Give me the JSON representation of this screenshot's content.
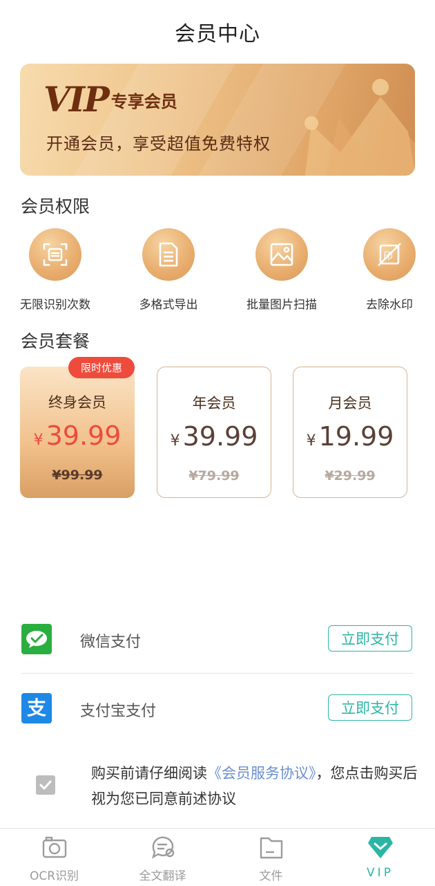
{
  "page": {
    "title": "会员中心"
  },
  "banner": {
    "vip_text": "VIP",
    "subtitle": "专享会员",
    "description": "开通会员，享受超值免费特权"
  },
  "perks": {
    "section_title": "会员权限",
    "items": [
      {
        "label": "无限识别次数",
        "icon": "scan-icon"
      },
      {
        "label": "多格式导出",
        "icon": "document-icon"
      },
      {
        "label": "批量图片扫描",
        "icon": "image-icon"
      },
      {
        "label": "去除水印",
        "icon": "no-watermark-icon"
      }
    ]
  },
  "plans": {
    "section_title": "会员套餐",
    "items": [
      {
        "name": "终身会员",
        "currency": "¥",
        "price": "39.99",
        "original": "¥99.99",
        "badge": "限时优惠",
        "selected": true
      },
      {
        "name": "年会员",
        "currency": "¥",
        "price": "39.99",
        "original": "¥79.99",
        "selected": false
      },
      {
        "name": "月会员",
        "currency": "¥",
        "price": "19.99",
        "original": "¥29.99",
        "selected": false
      }
    ]
  },
  "payment": {
    "methods": [
      {
        "label": "微信支付",
        "button": "立即支付",
        "icon": "wechat-pay-icon",
        "color": "#2aae3f"
      },
      {
        "label": "支付宝支付",
        "button": "立即支付",
        "icon": "alipay-icon",
        "color": "#1e88e5"
      }
    ]
  },
  "agreement": {
    "checked": true,
    "text_before": "购买前请仔细阅读",
    "link": "《会员服务协议》",
    "text_after": "，您点击购买后视为您已同意前述协议"
  },
  "tabbar": {
    "items": [
      {
        "label": "OCR识别",
        "icon": "camera-icon",
        "active": false
      },
      {
        "label": "全文翻译",
        "icon": "translate-icon",
        "active": false
      },
      {
        "label": "文件",
        "icon": "folder-icon",
        "active": false
      },
      {
        "label": "VIP",
        "icon": "vip-diamond-icon",
        "active": true
      }
    ]
  },
  "colors": {
    "accent": "#2bb5a5",
    "price_red": "#ee4b3c",
    "gold": "#e8ac6c"
  }
}
